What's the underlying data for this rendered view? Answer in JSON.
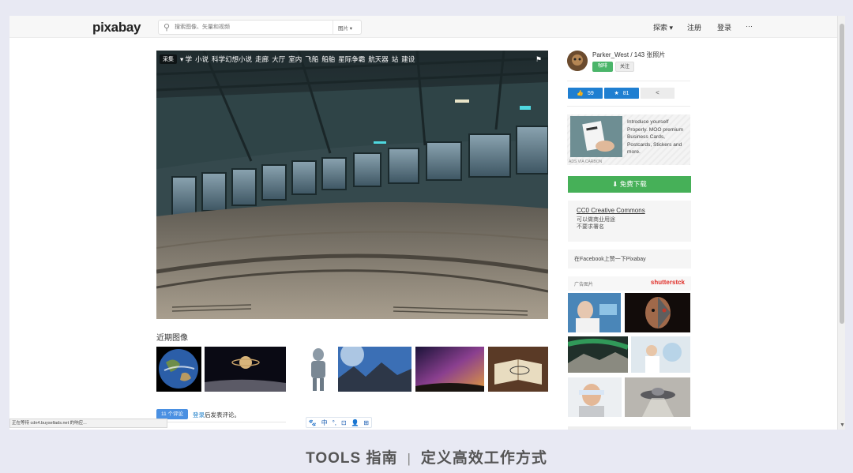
{
  "header": {
    "logo": "pixabay",
    "search_placeholder": "搜索图像、矢量和视频",
    "search_type": "图片 ▾",
    "nav": [
      "探索 ▾",
      "注册",
      "登录",
      "···"
    ]
  },
  "hero": {
    "collect_label": "采集",
    "categories": [
      "▾ 学",
      "小说",
      "科学幻想小说",
      "走廊",
      "大厅",
      "室内",
      "飞船",
      "船舶",
      "星际争霸",
      "航天器",
      "站",
      "建设"
    ],
    "flag_icon": "⚑"
  },
  "recent": {
    "title": "近期图像"
  },
  "comments": {
    "count_label": "11 个评论",
    "login_link": "登录",
    "login_rest": "后发表评论。"
  },
  "toolbar_icons": [
    "🐾",
    "中",
    "°,",
    "⊡",
    "👤",
    "⊞"
  ],
  "sidebar": {
    "user": "Parker_West / 143 张照片",
    "donate_label": "咖啡",
    "follow_label": "关注",
    "likes": "59",
    "favorites": "81",
    "ad_text": "Introduce yourself Properly. MOO premium Business Cards, Postcards, Stickers and more.",
    "ad_via": "ADS VIA CARBON",
    "download_label": "⬇ 免费下载",
    "license_title": "CC0 Creative Commons",
    "license_lines": [
      "可以做商业用途",
      "不要求署名"
    ],
    "facebook_text": "在Facebook上赞一下Pixabay",
    "sponsor_label": "广告图片",
    "sponsor_brand": "shutterstck"
  },
  "status_bar": "正在等待 cdn4.buysellads.net 的响应...",
  "footer": {
    "left": "TOOLS 指南",
    "sep": "|",
    "right": "定义高效工作方式"
  },
  "colors": {
    "download": "#46b058",
    "stat": "#1f7fd1",
    "link": "#1a7cc8",
    "shutterstock": "#e0312b"
  }
}
